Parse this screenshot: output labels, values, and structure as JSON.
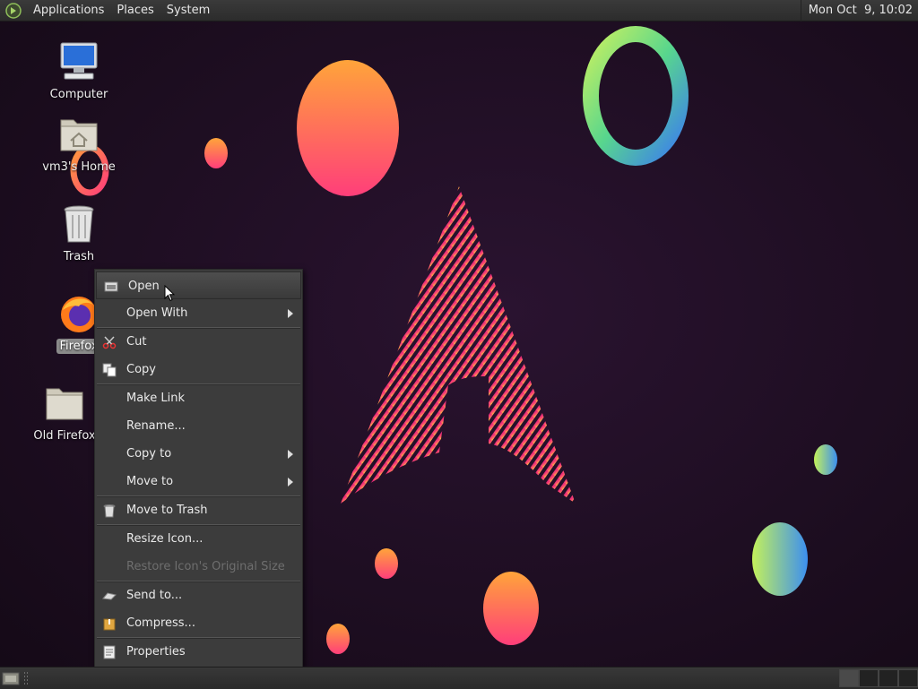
{
  "top_panel": {
    "menus": [
      "Applications",
      "Places",
      "System"
    ],
    "clock": "Mon Oct  9, 10:02"
  },
  "desktop_icons": [
    {
      "label": "Computer",
      "icon": "computer-icon"
    },
    {
      "label": "vm3's Home",
      "icon": "home-folder-icon"
    },
    {
      "label": "Trash",
      "icon": "trash-icon"
    },
    {
      "label": "Firefox",
      "icon": "firefox-icon",
      "selected": true
    },
    {
      "label": "Old Firefox",
      "icon": "folder-icon"
    }
  ],
  "context_menu": {
    "items": [
      {
        "label": "Open",
        "icon": "open-icon"
      },
      {
        "label": "Open With",
        "submenu": true
      },
      {
        "label": "Cut",
        "icon": "scissors-icon"
      },
      {
        "label": "Copy",
        "icon": "copy-icon"
      },
      {
        "label": "Make Link"
      },
      {
        "label": "Rename..."
      },
      {
        "label": "Copy to",
        "submenu": true
      },
      {
        "label": "Move to",
        "submenu": true
      },
      {
        "label": "Move to Trash",
        "icon": "trash-icon"
      },
      {
        "label": "Resize Icon..."
      },
      {
        "label": "Restore Icon's Original Size",
        "disabled": true
      },
      {
        "label": "Send to...",
        "icon": "send-icon"
      },
      {
        "label": "Compress...",
        "icon": "archive-icon"
      },
      {
        "label": "Properties",
        "icon": "properties-icon"
      }
    ]
  },
  "colors": {
    "background": "#1a0d1d",
    "panel": "#333333",
    "menu_bg": "#3c3c3c",
    "accent_pink": "#e8247a",
    "accent_orange": "#ff9a3c"
  }
}
